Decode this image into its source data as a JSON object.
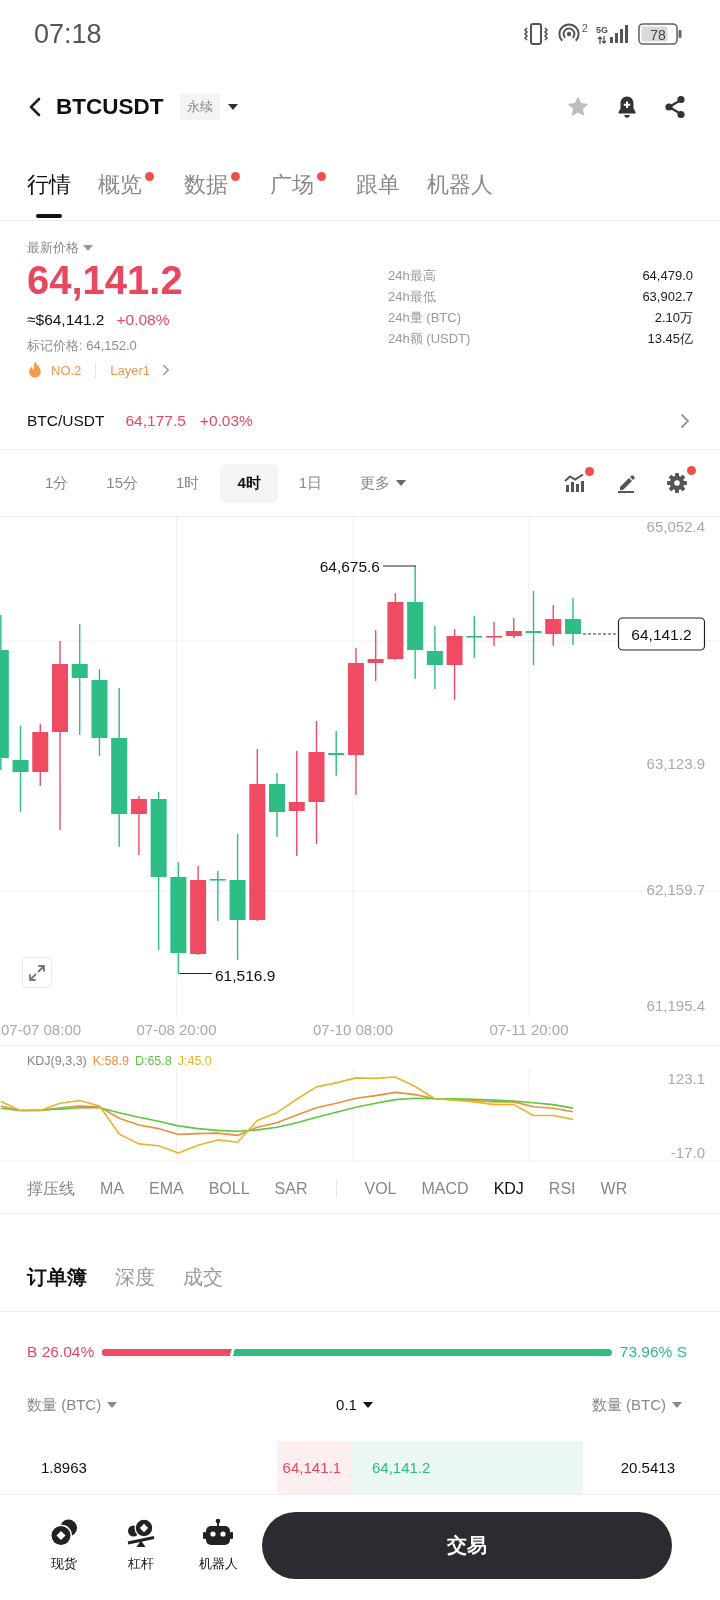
{
  "status_bar": {
    "time": "07:18",
    "hotspot_count": "2",
    "network": "5G",
    "battery": "78"
  },
  "header": {
    "title": "BTCUSDT",
    "contract_tag": "永续",
    "favorited": false
  },
  "tabs": [
    {
      "label": "行情",
      "selected": true,
      "dot": false
    },
    {
      "label": "概览",
      "selected": false,
      "dot": true
    },
    {
      "label": "数据",
      "selected": false,
      "dot": true
    },
    {
      "label": "广场",
      "selected": false,
      "dot": true
    },
    {
      "label": "跟单",
      "selected": false,
      "dot": false
    },
    {
      "label": "机器人",
      "selected": false,
      "dot": false
    }
  ],
  "price": {
    "label": "最新价格",
    "last": "64,141.2",
    "usd": "≈$64,141.2",
    "change": "+0.08%",
    "mark": "标记价格: 64,152.0",
    "rank": "NO.2",
    "sector": "Layer1"
  },
  "stats": [
    {
      "label": "24h最高",
      "value": "64,479.0"
    },
    {
      "label": "24h最低",
      "value": "63,902.7"
    },
    {
      "label": "24h量 (BTC)",
      "value": "2.10万"
    },
    {
      "label": "24h额 (USDT)",
      "value": "13.45亿"
    }
  ],
  "spot": {
    "pair": "BTC/USDT",
    "price": "64,177.5",
    "change": "+0.03%"
  },
  "intervals": [
    {
      "label": "1分",
      "selected": false,
      "kind": "option"
    },
    {
      "label": "15分",
      "selected": false,
      "kind": "option"
    },
    {
      "label": "1时",
      "selected": false,
      "kind": "option"
    },
    {
      "label": "4时",
      "selected": true,
      "kind": "option"
    },
    {
      "label": "1日",
      "selected": false,
      "kind": "option"
    },
    {
      "label": "更多",
      "selected": false,
      "kind": "menu"
    }
  ],
  "chart_tools": [
    {
      "kind": "indicators",
      "dot": true
    },
    {
      "kind": "drawing",
      "dot": false
    },
    {
      "kind": "settings",
      "dot": true
    }
  ],
  "candle_chart": {
    "price_labels": [
      "65,052.4",
      "63,123.9",
      "62,159.7",
      "61,195.4"
    ],
    "time_labels": [
      "07-07 08:00",
      "07-08 20:00",
      "07-10 08:00",
      "07-11 20:00"
    ],
    "high_label": "64,675.6",
    "low_label": "61,516.9",
    "last_price": "64,141.2"
  },
  "indicator_panel": {
    "title": "KDJ(9,3,3)",
    "readings": [
      {
        "text": "K:58.9",
        "color": "#e8913a"
      },
      {
        "text": "D:65.8",
        "color": "#5cc83f"
      },
      {
        "text": "J:45.0",
        "color": "#e8b52a"
      }
    ],
    "scale_labels": [
      "123.1",
      "-17.0"
    ]
  },
  "main_indicators": [
    {
      "label": "撑压线",
      "selected": false
    },
    {
      "label": "MA",
      "selected": false
    },
    {
      "label": "EMA",
      "selected": false
    },
    {
      "label": "BOLL",
      "selected": false
    },
    {
      "label": "SAR",
      "selected": false
    }
  ],
  "sub_indicators": [
    {
      "label": "VOL",
      "selected": false
    },
    {
      "label": "MACD",
      "selected": false
    },
    {
      "label": "KDJ",
      "selected": true
    },
    {
      "label": "RSI",
      "selected": false
    },
    {
      "label": "WR",
      "selected": false
    }
  ],
  "order_book": {
    "tabs": [
      {
        "label": "订单簿",
        "selected": true
      },
      {
        "label": "深度",
        "selected": false
      },
      {
        "label": "成交",
        "selected": false
      }
    ],
    "buy_ratio": {
      "label": "B 26.04%",
      "level": 0.2604
    },
    "sell_ratio": {
      "label": "73.96% S"
    },
    "columns": [
      {
        "label": "数量 (BTC)"
      },
      {
        "label": "0.1"
      },
      {
        "label": "数量 (BTC)"
      }
    ],
    "rows": [
      {
        "bid": {
          "qty": "1.8963",
          "price": "64,141.1"
        },
        "ask": {
          "price": "64,141.2",
          "qty": "20.5413"
        }
      }
    ]
  },
  "bottom_nav": {
    "items": [
      {
        "label": "现货"
      },
      {
        "label": "杠杆"
      },
      {
        "label": "机器人"
      }
    ],
    "trade_button": "交易"
  }
}
